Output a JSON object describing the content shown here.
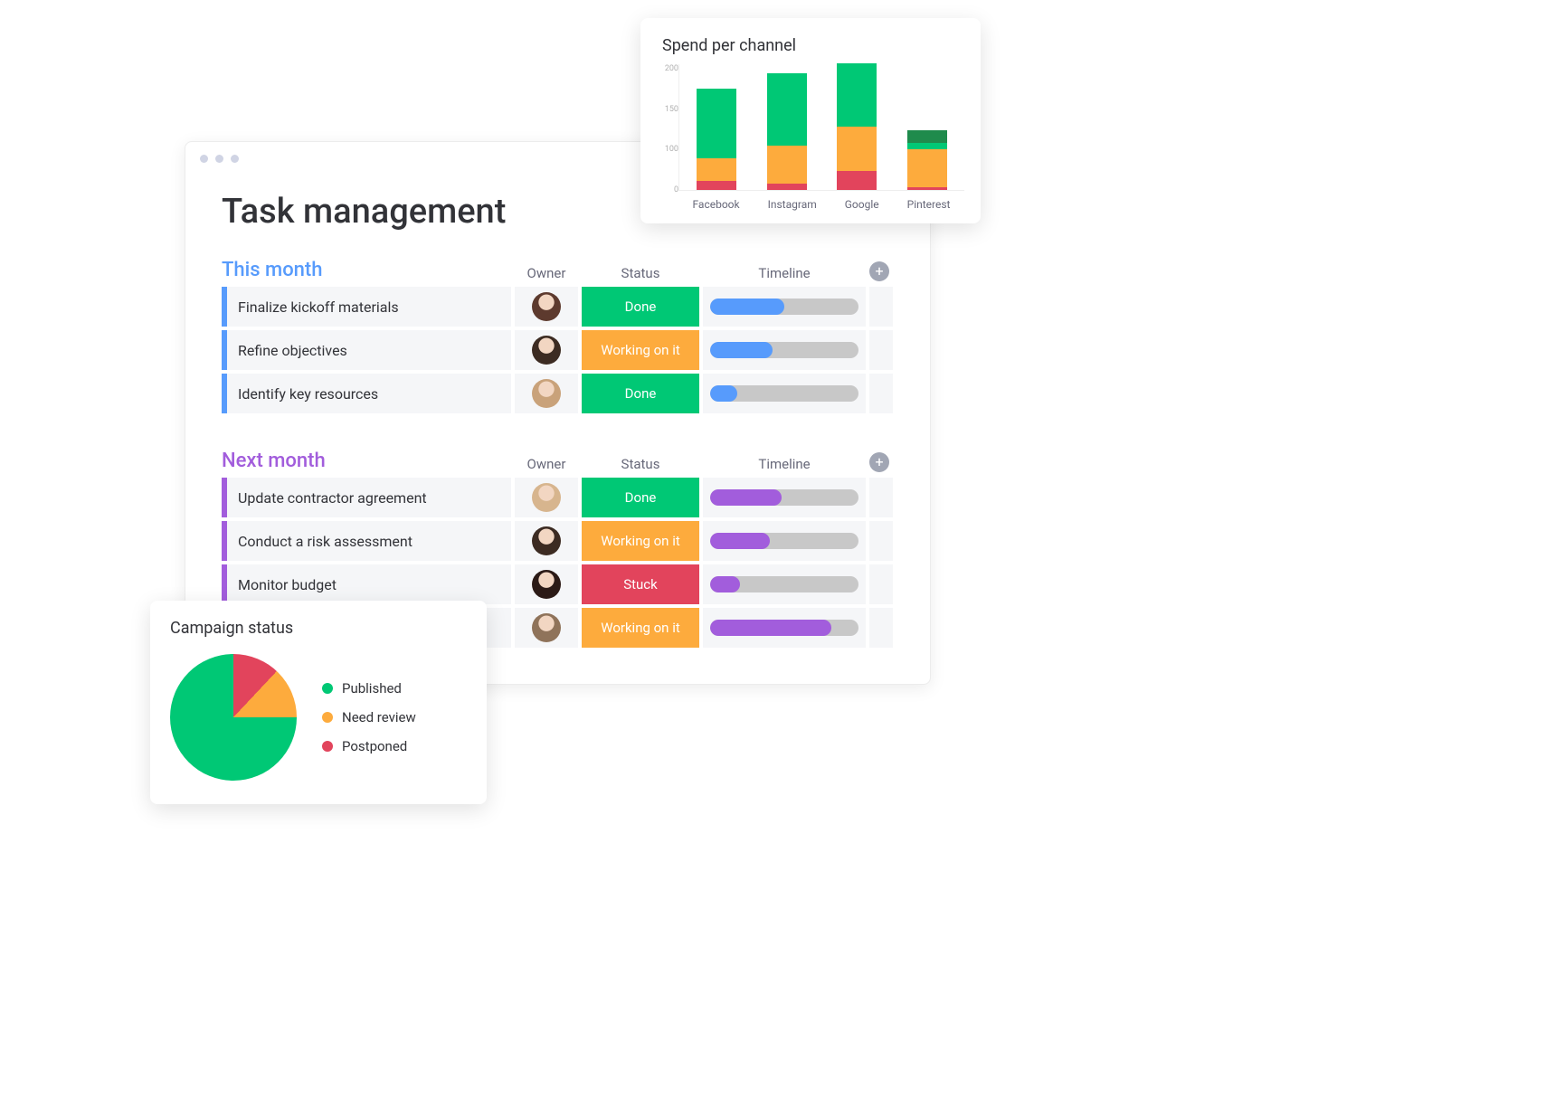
{
  "colors": {
    "green": "#00c875",
    "dark_green": "#1f8b4c",
    "orange": "#fdab3d",
    "red": "#e2445c",
    "blue": "#579bfc",
    "purple": "#a25ddc",
    "grey_track": "#c8c8c8",
    "light_green_ring": "#b6ebd4"
  },
  "page": {
    "title": "Task management"
  },
  "columns": {
    "owner": "Owner",
    "status": "Status",
    "timeline": "Timeline"
  },
  "groups": [
    {
      "id": "this_month",
      "title": "This month",
      "accent": "#579bfc",
      "title_color": "#579bfc",
      "rows": [
        {
          "task": "Finalize kickoff materials",
          "avatar_bg": "#5d3a2e",
          "status_label": "Done",
          "status_color": "#00c875",
          "timeline_start": 0,
          "timeline_width": 50,
          "timeline_color": "#579bfc"
        },
        {
          "task": "Refine objectives",
          "avatar_bg": "#3c2b22",
          "status_label": "Working on it",
          "status_color": "#fdab3d",
          "timeline_start": 0,
          "timeline_width": 42,
          "timeline_color": "#579bfc"
        },
        {
          "task": "Identify key resources",
          "avatar_bg": "#c9a27a",
          "status_label": "Done",
          "status_color": "#00c875",
          "timeline_start": 0,
          "timeline_width": 18,
          "timeline_color": "#579bfc"
        }
      ]
    },
    {
      "id": "next_month",
      "title": "Next month",
      "accent": "#a25ddc",
      "title_color": "#a25ddc",
      "rows": [
        {
          "task": "Update contractor agreement",
          "avatar_bg": "#d7b58e",
          "status_label": "Done",
          "status_color": "#00c875",
          "timeline_start": 0,
          "timeline_width": 48,
          "timeline_color": "#a25ddc"
        },
        {
          "task": "Conduct a risk assessment",
          "avatar_bg": "#3c2b22",
          "status_label": "Working on it",
          "status_color": "#fdab3d",
          "timeline_start": 0,
          "timeline_width": 40,
          "timeline_color": "#a25ddc"
        },
        {
          "task": "Monitor budget",
          "avatar_bg": "#2b1a16",
          "status_label": "Stuck",
          "status_color": "#e2445c",
          "timeline_start": 0,
          "timeline_width": 20,
          "timeline_color": "#a25ddc"
        },
        {
          "task": "",
          "avatar_bg": "#8f735a",
          "status_label": "Working on it",
          "status_color": "#fdab3d",
          "timeline_start": 0,
          "timeline_width": 82,
          "timeline_color": "#a25ddc"
        }
      ]
    }
  ],
  "spend_card": {
    "title": "Spend per channel"
  },
  "chart_data": [
    {
      "id": "spend_per_channel",
      "type": "bar",
      "stacked": true,
      "title": "Spend per channel",
      "xlabel": "",
      "ylabel": "",
      "ylim": [
        0,
        200
      ],
      "y_ticks": [
        0,
        100,
        150,
        200
      ],
      "categories": [
        "Facebook",
        "Instagram",
        "Google",
        "Pinterest"
      ],
      "series": [
        {
          "name": "red",
          "color": "#e2445c",
          "values": [
            15,
            10,
            30,
            5
          ]
        },
        {
          "name": "orange",
          "color": "#fdab3d",
          "values": [
            35,
            60,
            70,
            60
          ]
        },
        {
          "name": "green",
          "color": "#00c875",
          "values": [
            110,
            115,
            100,
            10
          ]
        },
        {
          "name": "dark_green",
          "color": "#1f8b4c",
          "values": [
            0,
            0,
            0,
            20
          ]
        }
      ]
    },
    {
      "id": "campaign_status",
      "type": "pie",
      "title": "Campaign status",
      "slices": [
        {
          "label": "Published",
          "value": 75,
          "color": "#00c875"
        },
        {
          "label": "Need review",
          "value": 13,
          "color": "#fdab3d"
        },
        {
          "label": "Postponed",
          "value": 12,
          "color": "#e2445c"
        }
      ]
    }
  ],
  "campaign_card": {
    "title": "Campaign status",
    "legend": [
      {
        "label": "Published",
        "color": "#00c875"
      },
      {
        "label": "Need review",
        "color": "#fdab3d"
      },
      {
        "label": "Postponed",
        "color": "#e2445c"
      }
    ]
  }
}
